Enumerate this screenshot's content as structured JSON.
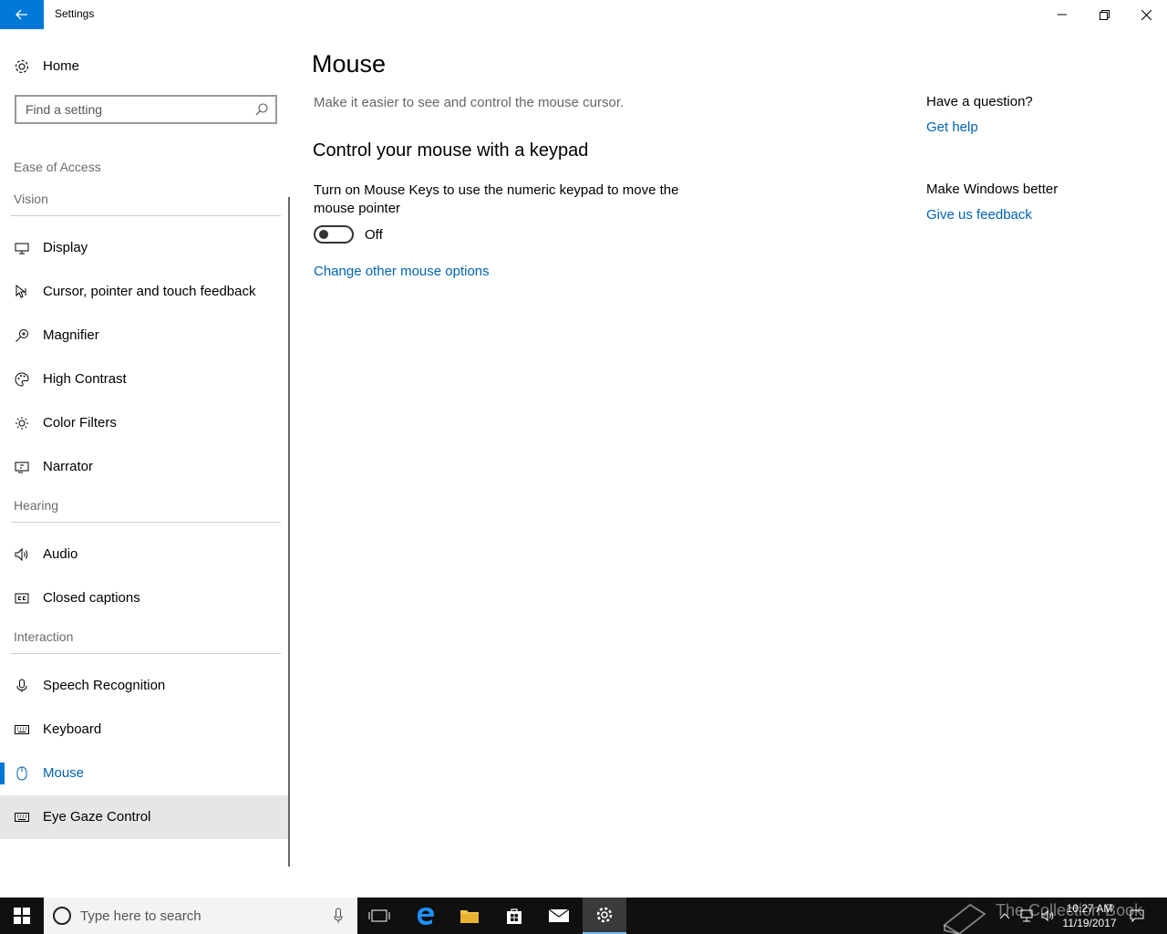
{
  "window": {
    "title": "Settings"
  },
  "sidebar": {
    "home_label": "Home",
    "search_placeholder": "Find a setting",
    "breadcrumb": "Ease of Access",
    "groups": {
      "vision": "Vision",
      "hearing": "Hearing",
      "interaction": "Interaction"
    },
    "items": {
      "display": "Display",
      "cursor": "Cursor, pointer and touch feedback",
      "magnifier": "Magnifier",
      "high_contrast": "High Contrast",
      "color_filters": "Color Filters",
      "narrator": "Narrator",
      "audio": "Audio",
      "closed_captions": "Closed captions",
      "speech": "Speech Recognition",
      "keyboard": "Keyboard",
      "mouse": "Mouse",
      "eye_gaze": "Eye Gaze Control"
    },
    "selected_item": "Mouse"
  },
  "main": {
    "title": "Mouse",
    "description": "Make it easier to see and control the mouse cursor.",
    "section_heading": "Control your mouse with a keypad",
    "mouse_keys": {
      "description": "Turn on Mouse Keys to use the numeric keypad to move the mouse pointer",
      "state_label": "Off",
      "on": false
    },
    "change_link": "Change other mouse options"
  },
  "aside": {
    "question_heading": "Have a question?",
    "help_link": "Get help",
    "feedback_heading": "Make Windows better",
    "feedback_link": "Give us feedback"
  },
  "taskbar": {
    "search_placeholder": "Type here to search",
    "time": "10:27 AM",
    "date": "11/19/2017",
    "watermark": "The Collection Book"
  },
  "colors": {
    "accent": "#0078d7",
    "link": "#0063b1",
    "taskbar": "#101010"
  }
}
